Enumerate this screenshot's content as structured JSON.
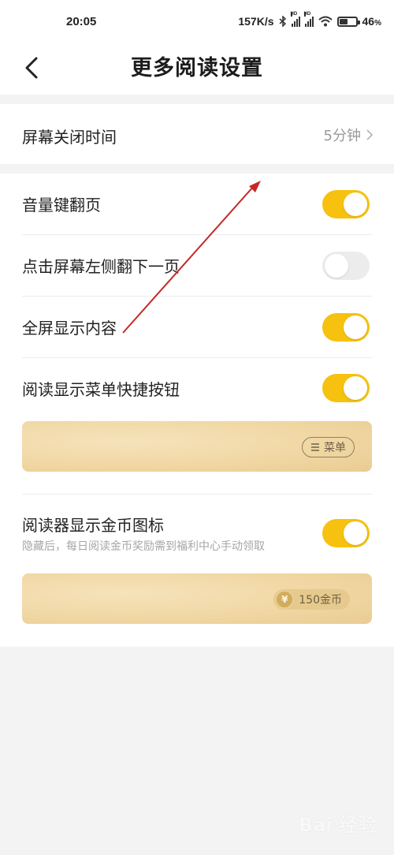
{
  "status_bar": {
    "time": "20:05",
    "network_speed": "157K/s",
    "battery_percent": "46",
    "battery_suffix": "%",
    "hd_label": "HD"
  },
  "nav": {
    "title": "更多阅读设置",
    "back_icon": "chevron-left-icon"
  },
  "screen_off": {
    "label": "屏幕关闭时间",
    "value": "5分钟",
    "icon": "chevron-right-icon"
  },
  "settings": [
    {
      "label": "音量键翻页",
      "on": true
    },
    {
      "label": "点击屏幕左侧翻下一页",
      "on": false
    },
    {
      "label": "全屏显示内容",
      "on": true
    },
    {
      "label": "阅读显示菜单快捷按钮",
      "on": true
    }
  ],
  "menu_preview": {
    "pill_icon": "menu-icon",
    "pill_label": "菜单"
  },
  "coin_setting": {
    "label": "阅读器显示金币图标",
    "description": "隐藏后，每日阅读金币奖励需到福利中心手动领取",
    "on": true
  },
  "coin_preview": {
    "coin_symbol": "¥",
    "label": "150金币"
  },
  "colors": {
    "toggle_on": "#f7c10f",
    "toggle_off": "#ececec",
    "annotation_arrow": "#c62828"
  },
  "watermark": "Bai 经验"
}
